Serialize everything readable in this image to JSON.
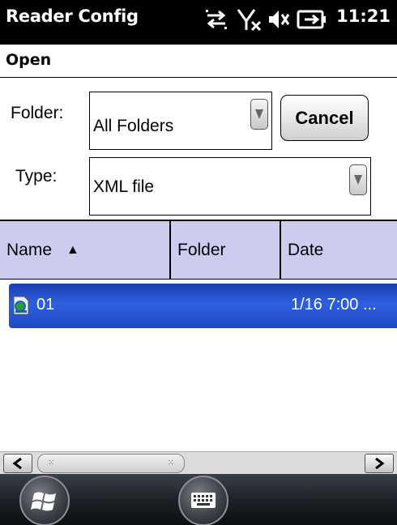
{
  "status_bar": {
    "title": "Reader Config",
    "time": "11:21",
    "icons": [
      "sync-arrows-icon",
      "no-signal-icon",
      "volume-mute-icon",
      "battery-charging-icon"
    ]
  },
  "menu": {
    "open_label": "Open"
  },
  "form": {
    "folder_label": "Folder:",
    "folder_value": "All Folders",
    "type_label": "Type:",
    "type_value": "XML file",
    "cancel_label": "Cancel"
  },
  "list": {
    "columns": [
      "Name",
      "Folder",
      "Date"
    ],
    "sort_indicator": "▲",
    "rows": [
      {
        "name": "01",
        "folder": "",
        "date": "1/16 7:00 ..."
      }
    ]
  },
  "taskbar": {
    "icons": [
      "windows-start-icon",
      "keyboard-icon"
    ]
  },
  "colors": {
    "header_bg": "#ccccf0",
    "selection": "#2d5fe0",
    "statusbar": "#000000"
  }
}
